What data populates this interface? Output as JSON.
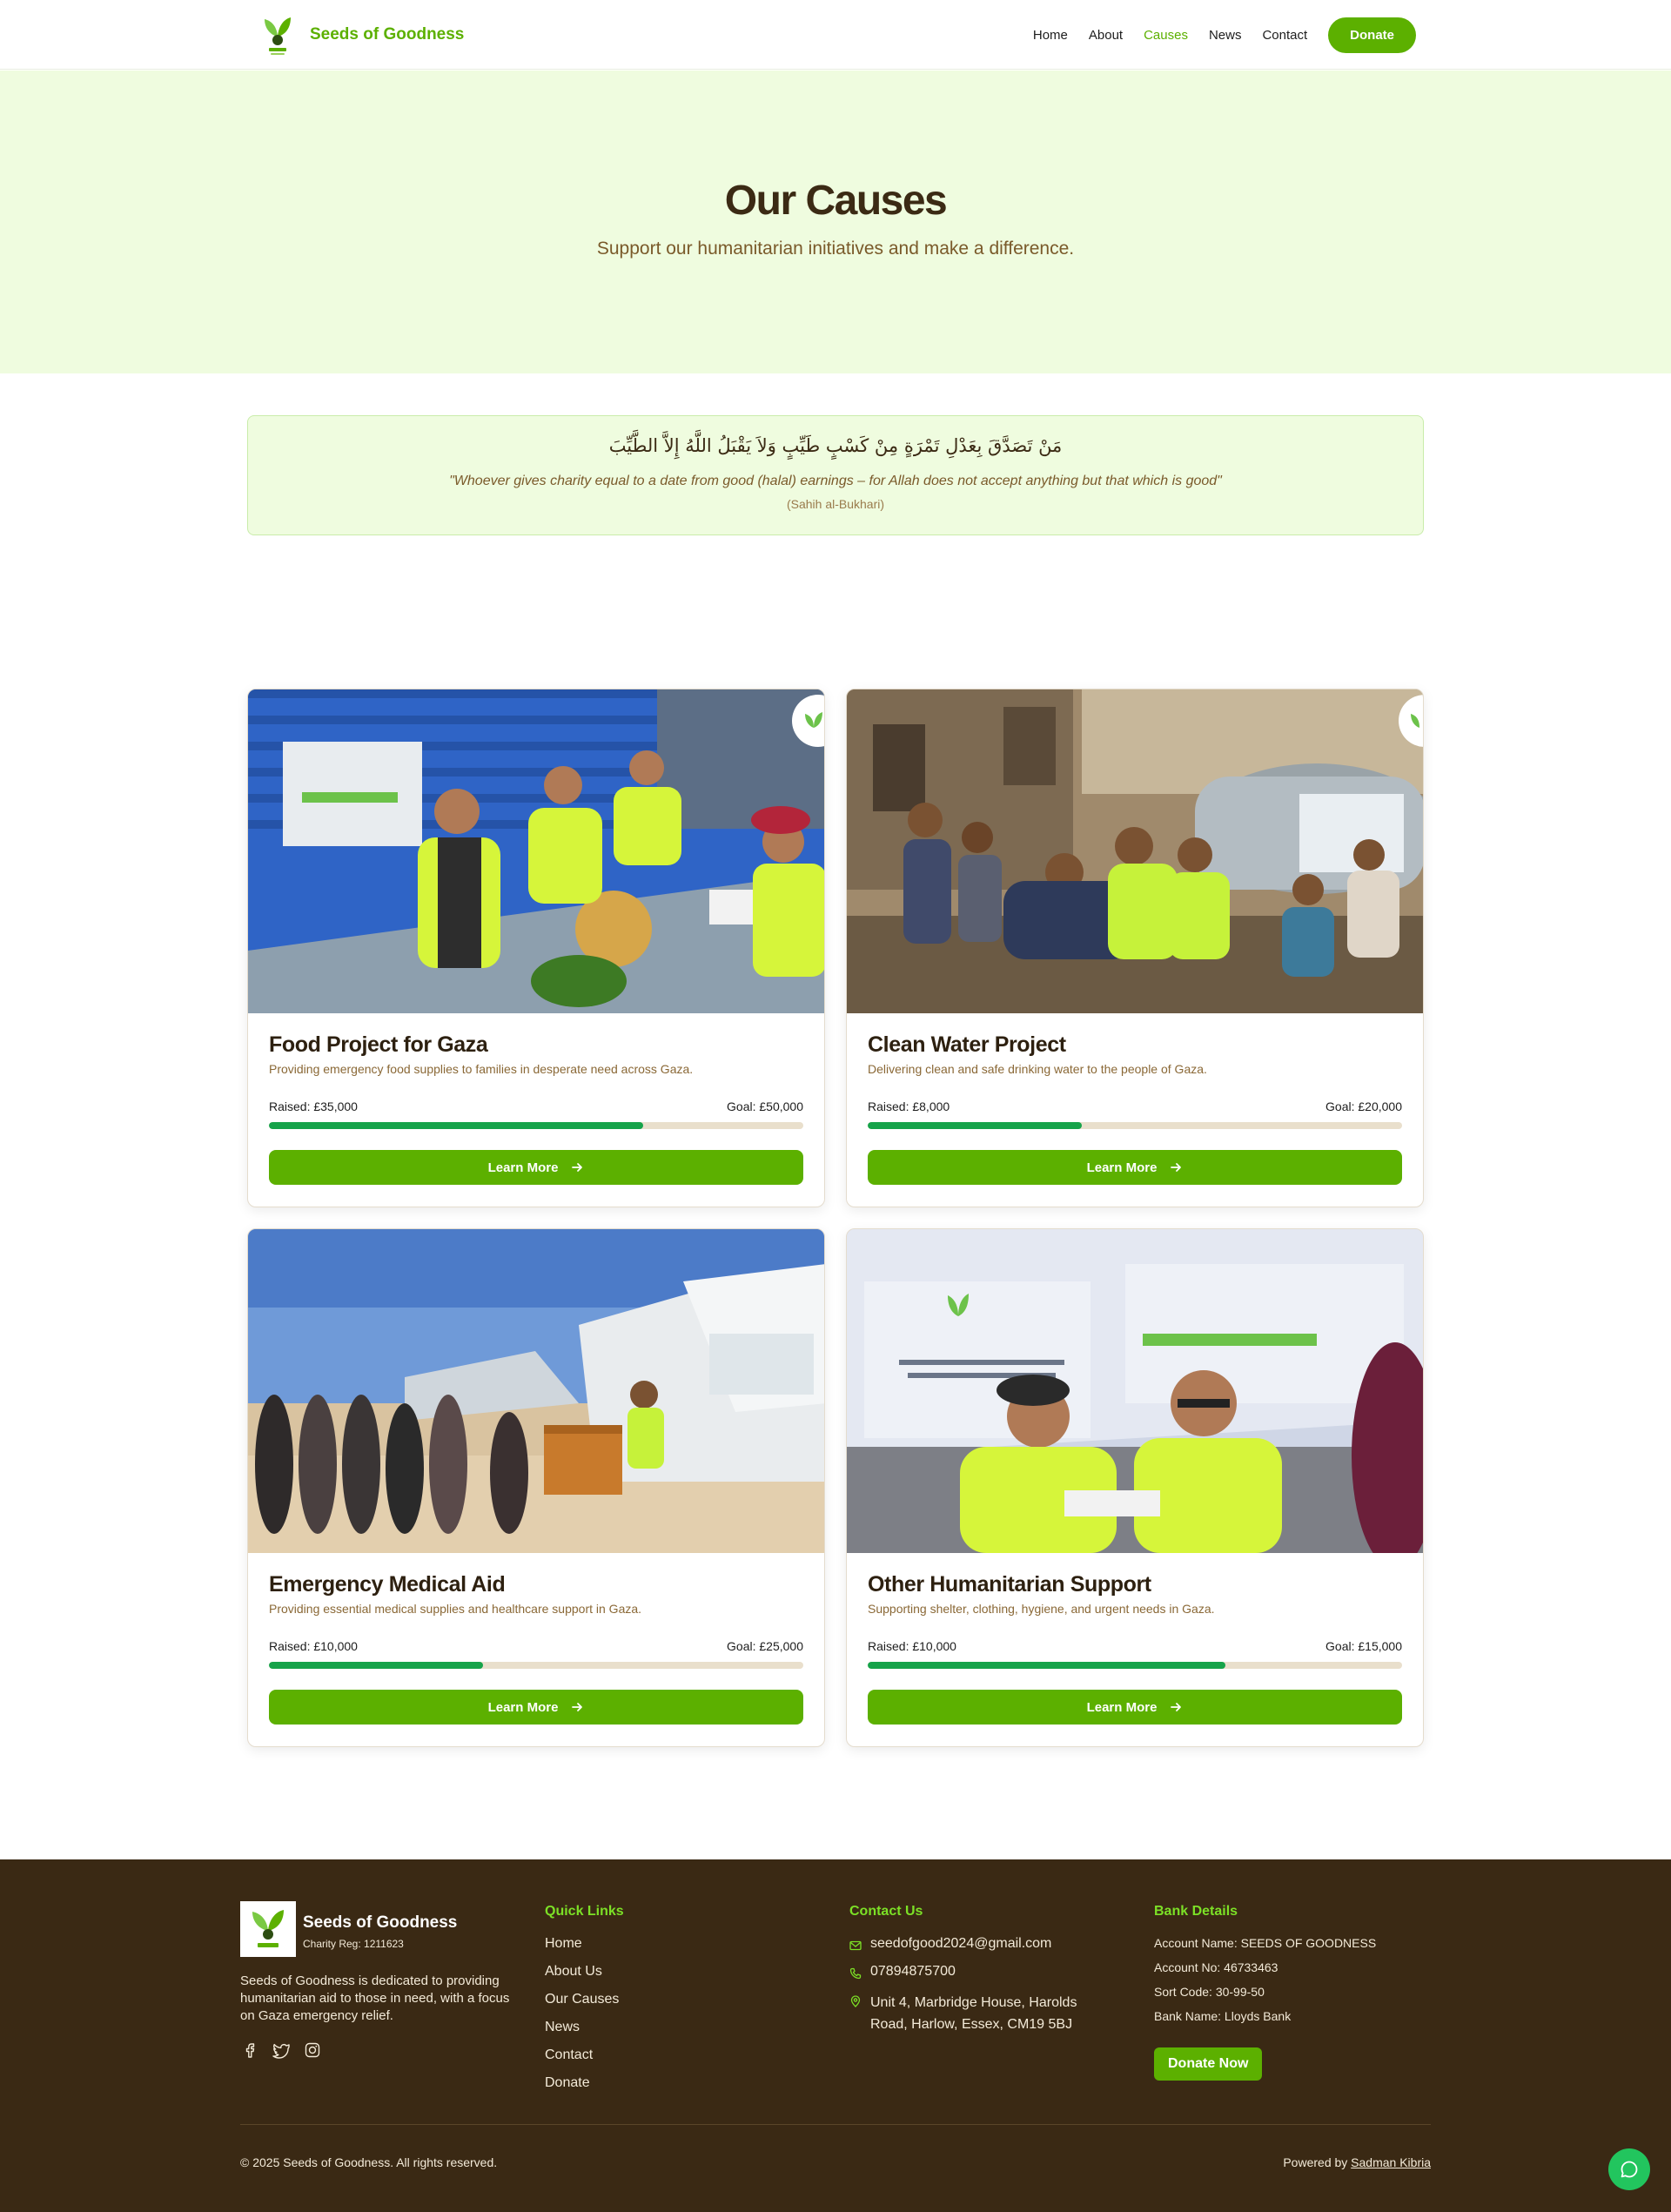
{
  "header": {
    "brand": "Seeds of Goodness",
    "nav": [
      "Home",
      "About",
      "Causes",
      "News",
      "Contact"
    ],
    "active_nav": "Causes",
    "donate_label": "Donate"
  },
  "hero": {
    "title": "Our Causes",
    "subtitle": "Support our humanitarian initiatives and make a difference."
  },
  "quote": {
    "arabic": "مَنْ تَصَدَّقَ بِعَدْلِ تَمْرَةٍ مِنْ كَسْبٍ طَيِّبٍ وَلاَ يَقْبَلُ اللَّهُ إِلاَّ الطَّيِّبَ",
    "english": "\"Whoever gives charity equal to a date from good (halal) earnings – for Allah does not accept anything but that which is good\"",
    "source": "(Sahih al-Bukhari)"
  },
  "causes": [
    {
      "title": "Food Project for Gaza",
      "description": "Providing emergency food supplies to families in desperate need across Gaza.",
      "raised": "Raised: £35,000",
      "goal": "Goal: £50,000",
      "progress": 0.7,
      "button": "Learn More"
    },
    {
      "title": "Clean Water Project",
      "description": "Delivering clean and safe drinking water to the people of Gaza.",
      "raised": "Raised: £8,000",
      "goal": "Goal: £20,000",
      "progress": 0.4,
      "button": "Learn More"
    },
    {
      "title": "Emergency Medical Aid",
      "description": "Providing essential medical supplies and healthcare support in Gaza.",
      "raised": "Raised: £10,000",
      "goal": "Goal: £25,000",
      "progress": 0.4,
      "button": "Learn More"
    },
    {
      "title": "Other Humanitarian Support",
      "description": "Supporting shelter, clothing, hygiene, and urgent needs in Gaza.",
      "raised": "Raised: £10,000",
      "goal": "Goal: £15,000",
      "progress": 0.67,
      "button": "Learn More"
    }
  ],
  "footer": {
    "brand": "Seeds of Goodness",
    "charity_reg": "Charity Reg: 1211623",
    "about": "Seeds of Goodness is dedicated to providing humanitarian aid to those in need, with a focus on Gaza emergency relief.",
    "social_icons": [
      "facebook-icon",
      "twitter-icon",
      "instagram-icon"
    ],
    "quick_links_title": "Quick Links",
    "quick_links": [
      "Home",
      "About Us",
      "Our Causes",
      "News",
      "Contact",
      "Donate"
    ],
    "contact_title": "Contact Us",
    "email": "seedofgood2024@gmail.com",
    "phone": "07894875700",
    "address": "Unit 4, Marbridge House, Harolds Road, Harlow, Essex, CM19 5BJ",
    "bank_title": "Bank Details",
    "bank": [
      "Account Name: SEEDS OF GOODNESS",
      "Account No: 46733463",
      "Sort Code: 30-99-50",
      "Bank Name: Lloyds Bank"
    ],
    "donate_now": "Donate Now",
    "copyright": "© 2025 Seeds of Goodness. All rights reserved.",
    "powered_by": "Powered by",
    "powered_by_name": "Sadman Kibria"
  },
  "colors": {
    "brand_green": "#5cb000",
    "progress_green": "#16a34a",
    "hero_bg": "#effcdf",
    "footer_bg": "#3a2914",
    "footer_heading": "#7ce026",
    "dark_text": "#3b2a14"
  }
}
